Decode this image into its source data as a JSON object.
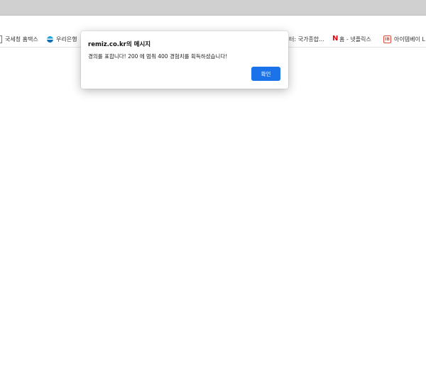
{
  "bookmarks": [
    {
      "label": "국세청 홈택스",
      "icon": "document-icon"
    },
    {
      "label": "우리은행",
      "icon": "woori-bank-icon"
    },
    {
      "label": "터: 국가종합...",
      "icon": ""
    },
    {
      "label": "홈 - 넷플릭스",
      "icon": "netflix-icon"
    },
    {
      "label": "아이템베이 L",
      "icon": "itembay-icon"
    }
  ],
  "dialog": {
    "title": "remiz.co.kr의 메시지",
    "message": "경의를 표합니다! 200 에 멈춰 400 경험치를 획득하셨습니다!",
    "confirm_label": "확인",
    "accent_color": "#1a73e8"
  }
}
